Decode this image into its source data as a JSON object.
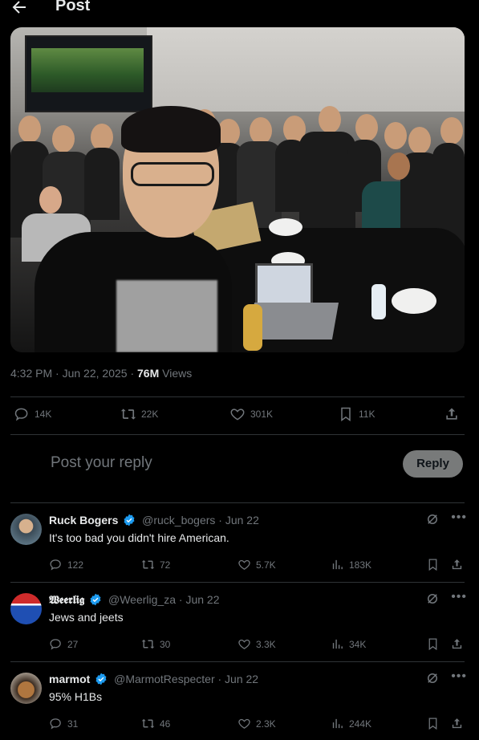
{
  "header": {
    "title": "Post"
  },
  "post": {
    "time": "4:32 PM",
    "date": "Jun 22, 2025",
    "views_count": "76M",
    "views_label": "Views",
    "stats": {
      "replies": "14K",
      "reposts": "22K",
      "likes": "301K",
      "bookmarks": "11K"
    }
  },
  "compose": {
    "placeholder": "Post your reply",
    "button": "Reply"
  },
  "replies": [
    {
      "name": "Ruck Bogers",
      "handle": "@ruck_bogers",
      "date": "· Jun 22",
      "text": "It's too bad you didn't hire American.",
      "stats": {
        "replies": "122",
        "reposts": "72",
        "likes": "5.7K",
        "views": "183K"
      }
    },
    {
      "name": "𝖂𝖊𝖊𝖗𝖑𝖎𝖌",
      "handle": "@Weerlig_za",
      "date": "· Jun 22",
      "text": "Jews and jeets",
      "stats": {
        "replies": "27",
        "reposts": "30",
        "likes": "3.3K",
        "views": "34K"
      }
    },
    {
      "name": "marmot",
      "handle": "@MarmotRespecter",
      "date": "· Jun 22",
      "text": "95% H1Bs",
      "stats": {
        "replies": "31",
        "reposts": "46",
        "likes": "2.3K",
        "views": "244K"
      }
    }
  ],
  "colors": {
    "verified": "#1d9bf0",
    "muted": "#71767b",
    "text": "#e7e9ea"
  }
}
